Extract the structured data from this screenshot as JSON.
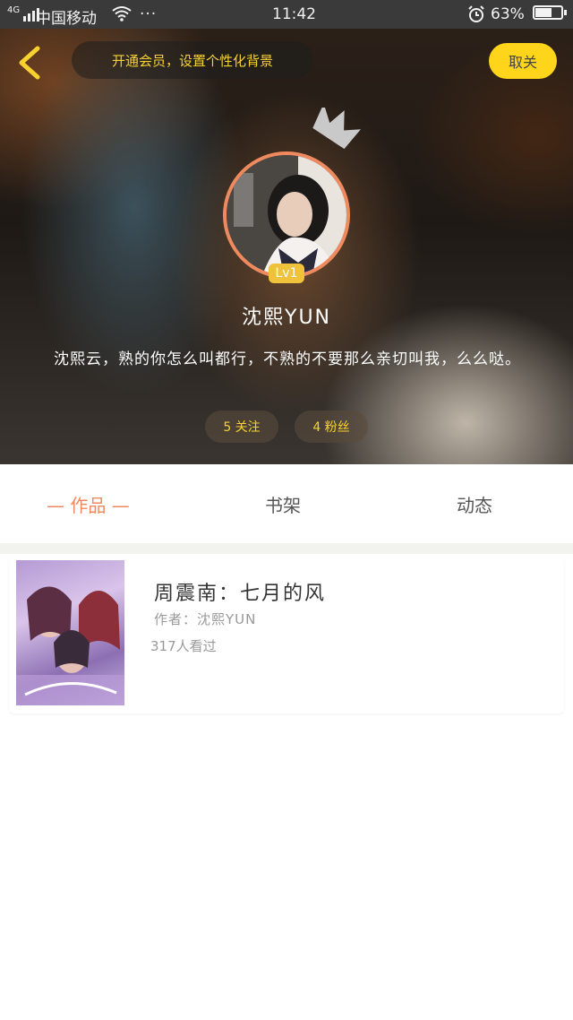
{
  "status_bar": {
    "network": "4G",
    "carrier": "中国移动",
    "more": "···",
    "time": "11:42",
    "battery_text": "63%",
    "battery_level": 0.63
  },
  "header": {
    "vip_promo": "开通会员，设置个性化背景",
    "follow_button": "取关"
  },
  "profile": {
    "level": "Lv1",
    "nickname": "沈熙YUN",
    "bio": "沈熙云，熟的你怎么叫都行，不熟的不要那么亲切叫我，么么哒。",
    "following_label": "5 关注",
    "fans_label": "4 粉丝"
  },
  "tabs": {
    "works": "— 作品 —",
    "bookshelf": "书架",
    "moments": "动态"
  },
  "book": {
    "title": "周震南：七月的风",
    "author": "作者：沈熙YUN",
    "views": "317人看过"
  },
  "colors": {
    "accent_orange": "#ef8a5e",
    "accent_yellow": "#ffd51c",
    "vip_text": "#f7d12f"
  }
}
